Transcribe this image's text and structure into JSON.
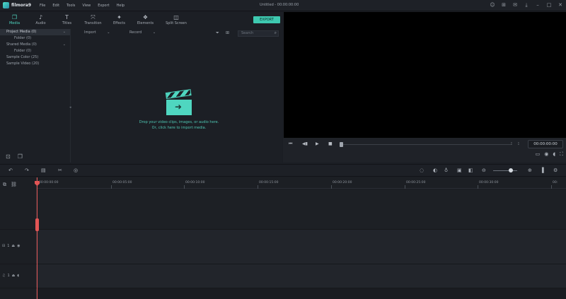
{
  "app": {
    "name": "filmora9",
    "project_title": "Untitled - 00:00:00:00"
  },
  "menu": [
    "File",
    "Edit",
    "Tools",
    "View",
    "Export",
    "Help"
  ],
  "library_tabs": [
    {
      "label": "Media",
      "icon": "folder-icon",
      "active": true
    },
    {
      "label": "Audio",
      "icon": "music-note-icon",
      "active": false
    },
    {
      "label": "Titles",
      "icon": "text-icon",
      "active": false
    },
    {
      "label": "Transition",
      "icon": "transition-icon",
      "active": false
    },
    {
      "label": "Effects",
      "icon": "effects-icon",
      "active": false
    },
    {
      "label": "Elements",
      "icon": "elements-icon",
      "active": false
    },
    {
      "label": "Split Screen",
      "icon": "split-screen-icon",
      "active": false
    }
  ],
  "export_label": "EXPORT",
  "sidebar": {
    "items": [
      {
        "label": "Project Media (0)",
        "chevron": "⌄",
        "active": true
      },
      {
        "label": "Folder (0)",
        "indent": true
      },
      {
        "label": "Shared Media (0)",
        "chevron": "⌄"
      },
      {
        "label": "Folder (0)",
        "indent": true
      },
      {
        "label": "Sample Color (25)"
      },
      {
        "label": "Sample Video (20)"
      }
    ]
  },
  "media_toolbar": {
    "import_label": "Import",
    "record_label": "Record",
    "search_placeholder": "Search"
  },
  "empty_state": {
    "line1": "Drop your video clips, images, or audio here.",
    "line2": "Or, click here to import media."
  },
  "preview": {
    "timecode": "00:00:00:00"
  },
  "ruler_ticks": [
    "00:00:00:00",
    "00:00:05:00",
    "00:00:10:00",
    "00:00:15:00",
    "00:00:20:00",
    "00:00:25:00",
    "00:00:30:00",
    "00:"
  ],
  "tracks": [
    {
      "label": "1",
      "kind": "video"
    },
    {
      "label": "1",
      "kind": "audio"
    }
  ]
}
